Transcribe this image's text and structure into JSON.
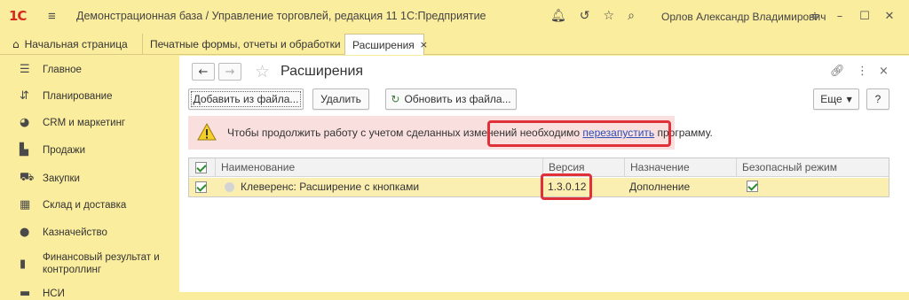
{
  "app": {
    "logo": "1С",
    "title": "Демонстрационная база / Управление торговлей, редакция 11 1С:Предприятие",
    "user": "Орлов Александр Владимирович"
  },
  "tabs": [
    {
      "label": "Начальная страница"
    },
    {
      "label": "Печатные формы, отчеты и обработки",
      "close": "×"
    },
    {
      "label": "Расширения",
      "close": "×"
    }
  ],
  "sidebar": {
    "items": [
      {
        "label": "Главное",
        "icon": "menu-icon"
      },
      {
        "label": "Планирование",
        "icon": "planning-icon"
      },
      {
        "label": "CRM и маркетинг",
        "icon": "crm-icon"
      },
      {
        "label": "Продажи",
        "icon": "bag-icon"
      },
      {
        "label": "Закупки",
        "icon": "cart-icon"
      },
      {
        "label": "Склад и доставка",
        "icon": "warehouse-icon"
      },
      {
        "label": "Казначейство",
        "icon": "ruble-icon"
      },
      {
        "label": "Финансовый результат и контроллинг",
        "icon": "chart-icon"
      },
      {
        "label": "НСИ",
        "icon": "catalog-icon"
      }
    ]
  },
  "form": {
    "title": "Расширения",
    "buttons": {
      "add_from_file": "Добавить из файла...",
      "delete": "Удалить",
      "update_from_file": "Обновить из файла...",
      "more": "Еще",
      "help": "?"
    },
    "warning": {
      "text_before": "Чтобы продолжить работу с учетом сделанных изменений необходимо ",
      "link": "перезапустить",
      "text_after": " программу."
    },
    "table": {
      "columns": [
        "Наименование",
        "Версия",
        "Назначение",
        "Безопасный режим"
      ],
      "rows": [
        {
          "name": "Клеверенс: Расширение с кнопками",
          "version": "1.3.0.12",
          "purpose": "Дополнение",
          "active": true,
          "safe_mode": true
        }
      ]
    }
  }
}
